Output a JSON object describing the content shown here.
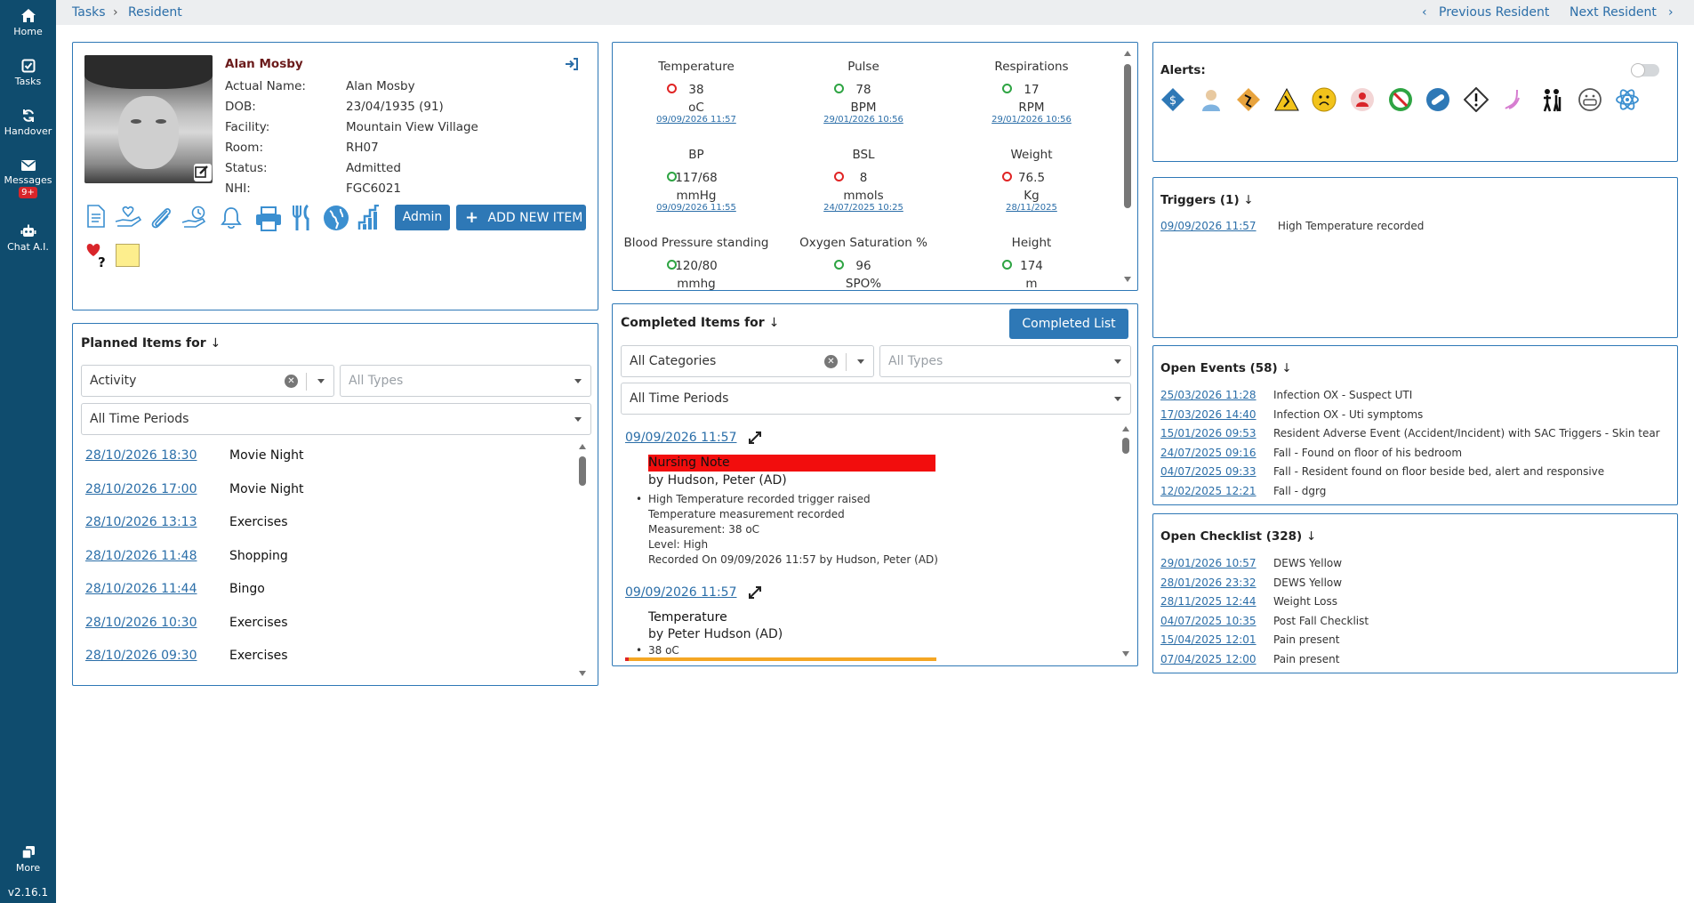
{
  "sidebar": {
    "items": [
      {
        "label": "Home",
        "icon": "home-icon"
      },
      {
        "label": "Tasks",
        "icon": "check-square-icon"
      },
      {
        "label": "Handover",
        "icon": "refresh-icon"
      },
      {
        "label": "Messages",
        "icon": "envelope-icon",
        "badge": "9+"
      },
      {
        "label": "Chat A.I.",
        "icon": "robot-icon"
      }
    ],
    "more": "More",
    "version": "v2.16.1"
  },
  "breadcrumb": {
    "first": "Tasks",
    "second": "Resident"
  },
  "nav": {
    "previous": "Previous Resident",
    "next": "Next Resident"
  },
  "resident": {
    "name": "Alan Mosby",
    "fields": [
      {
        "label": "Actual Name:",
        "value": "Alan Mosby"
      },
      {
        "label": "DOB:",
        "value": "23/04/1935 (91)"
      },
      {
        "label": "Facility:",
        "value": "Mountain View Village"
      },
      {
        "label": "Room:",
        "value": "RH07"
      },
      {
        "label": "Status:",
        "value": "Admitted"
      },
      {
        "label": "NHI:",
        "value": "FGC6021"
      }
    ],
    "admin_label": "Admin",
    "add_label": "ADD NEW ITEM"
  },
  "vitals": [
    {
      "name": "Temperature",
      "value": "38",
      "unit": "oC",
      "date": "09/09/2026 11:57",
      "status": "red"
    },
    {
      "name": "Pulse",
      "value": "78",
      "unit": "BPM",
      "date": "29/01/2026 10:56",
      "status": "green"
    },
    {
      "name": "Respirations",
      "value": "17",
      "unit": "RPM",
      "date": "29/01/2026 10:56",
      "status": "green"
    },
    {
      "name": "BP",
      "value": "117/68",
      "unit": "mmHg",
      "date": "09/09/2026 11:55",
      "status": "green"
    },
    {
      "name": "BSL",
      "value": "8",
      "unit": "mmols",
      "date": "24/07/2025 10:25",
      "status": "red"
    },
    {
      "name": "Weight",
      "value": "76.5",
      "unit": "Kg",
      "date": "28/11/2025",
      "status": "red"
    },
    {
      "name": "Blood Pressure standing",
      "value": "120/80",
      "unit": "mmhg",
      "date": "",
      "status": "green"
    },
    {
      "name": "Oxygen Saturation %",
      "value": "96",
      "unit": "SPO%",
      "date": "",
      "status": "green"
    },
    {
      "name": "Height",
      "value": "174",
      "unit": "m",
      "date": "",
      "status": "green"
    }
  ],
  "alerts": {
    "title": "Alerts:",
    "icons": [
      "diamond-badge-icon",
      "nurse-icon",
      "falls-sign-icon",
      "warning-triangle-icon",
      "sad-face-icon",
      "person-alert-icon",
      "no-symbol-icon",
      "medication-icon",
      "diamond-warning-icon",
      "continence-icon",
      "walking-aid-icon",
      "mask-face-icon",
      "atom-icon"
    ]
  },
  "triggers": {
    "title": "Triggers (1)",
    "rows": [
      {
        "date": "09/09/2026 11:57",
        "text": "High Temperature recorded"
      }
    ]
  },
  "open_events": {
    "title": "Open Events (58)",
    "rows": [
      {
        "date": "25/03/2026 11:28",
        "text": "Infection OX - Suspect UTI"
      },
      {
        "date": "17/03/2026 14:40",
        "text": "Infection OX - Uti symptoms"
      },
      {
        "date": "15/01/2026 09:53",
        "text": "Resident Adverse Event (Accident/Incident) with SAC Triggers - Skin tear"
      },
      {
        "date": "24/07/2025 09:16",
        "text": "Fall - Found on floor of his bedroom"
      },
      {
        "date": "04/07/2025 09:33",
        "text": "Fall - Resident found on floor beside bed, alert and responsive"
      },
      {
        "date": "12/02/2025 12:21",
        "text": "Fall - dgrg"
      }
    ]
  },
  "open_checklist": {
    "title": "Open Checklist (328)",
    "rows": [
      {
        "date": "29/01/2026 10:57",
        "text": "DEWS Yellow"
      },
      {
        "date": "28/01/2026 23:32",
        "text": "DEWS Yellow"
      },
      {
        "date": "28/11/2025 12:44",
        "text": "Weight Loss"
      },
      {
        "date": "04/07/2025 10:35",
        "text": "Post Fall Checklist"
      },
      {
        "date": "15/04/2025 12:01",
        "text": "Pain present"
      },
      {
        "date": "07/04/2025 12:00",
        "text": "Pain present"
      }
    ]
  },
  "planned": {
    "title": "Planned Items for",
    "filter_category": "Activity",
    "filter_types_placeholder": "All Types",
    "filter_period": "All Time Periods",
    "rows": [
      {
        "date": "28/10/2026 18:30",
        "text": "Movie Night"
      },
      {
        "date": "28/10/2026 17:00",
        "text": "Movie Night"
      },
      {
        "date": "28/10/2026 13:13",
        "text": "Exercises"
      },
      {
        "date": "28/10/2026 11:48",
        "text": "Shopping"
      },
      {
        "date": "28/10/2026 11:44",
        "text": "Bingo"
      },
      {
        "date": "28/10/2026 10:30",
        "text": "Exercises"
      },
      {
        "date": "28/10/2026 09:30",
        "text": "Exercises"
      }
    ]
  },
  "completed": {
    "title": "Completed Items for",
    "button": "Completed List",
    "filter_category": "All Categories",
    "filter_types_placeholder": "All Types",
    "filter_period": "All Time Periods",
    "entries": [
      {
        "date": "09/09/2026 11:57",
        "title": "Nursing Note",
        "by": "by Hudson, Peter (AD)",
        "bullet": "High Temperature recorded trigger raised",
        "lines": [
          "Temperature measurement recorded",
          "Measurement: 38 oC",
          "Level: High",
          "Recorded On 09/09/2026 11:57 by Hudson, Peter (AD)"
        ]
      },
      {
        "date": "09/09/2026 11:57",
        "title": "Temperature",
        "by": "by Peter Hudson (AD)",
        "bullet": "38 oC",
        "lines": []
      }
    ]
  }
}
